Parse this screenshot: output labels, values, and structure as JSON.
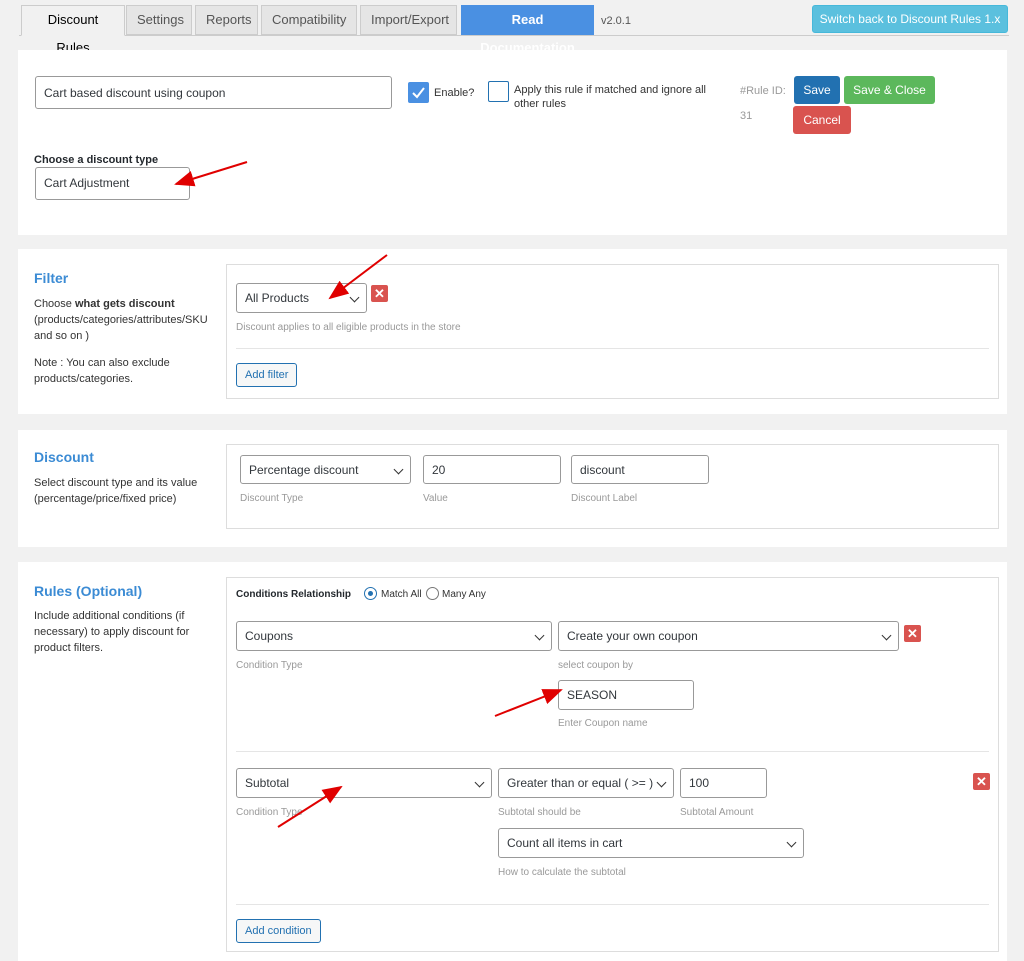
{
  "tabs": {
    "discount_rules": "Discount Rules",
    "settings": "Settings",
    "reports": "Reports",
    "compatibility": "Compatibility",
    "import_export": "Import/Export",
    "read_documentation": "Read Documentation",
    "version": "v2.0.1",
    "switch_back": "Switch back to Discount Rules 1.x"
  },
  "header": {
    "rule_name": "Cart based discount using coupon",
    "enable_label": "Enable?",
    "enable_checked": true,
    "apply_rule_label": "Apply this rule if matched and ignore all other rules",
    "apply_rule_checked": false,
    "rule_id_label": "#Rule ID:",
    "rule_id": "31",
    "save": "Save",
    "save_close": "Save & Close",
    "cancel": "Cancel",
    "discount_type_label": "Choose a discount type",
    "discount_type_value": "Cart Adjustment"
  },
  "filter": {
    "title": "Filter",
    "desc_prefix": "Choose ",
    "desc_bold": "what gets discount",
    "desc_suffix": "(products/categories/attributes/SKU and so on )",
    "note": "Note : You can also exclude products/categories.",
    "select_value": "All Products",
    "hint": "Discount applies to all eligible products in the store",
    "add_filter": "Add filter"
  },
  "discount": {
    "title": "Discount",
    "desc": "Select discount type and its value (percentage/price/fixed price)",
    "type_value": "Percentage discount",
    "type_label": "Discount Type",
    "value": "20",
    "value_label": "Value",
    "label_value": "discount",
    "label_label": "Discount Label"
  },
  "rules": {
    "title": "Rules (Optional)",
    "desc": "Include additional conditions (if necessary) to apply discount for product filters.",
    "relationship_label": "Conditions Relationship",
    "match_all": "Match All",
    "match_any": "Many Any",
    "condition1": {
      "type": "Coupons",
      "type_label": "Condition Type",
      "coupon_by": "Create your own coupon",
      "coupon_by_label": "select coupon by",
      "coupon_name": "SEASON",
      "coupon_name_label": "Enter Coupon name"
    },
    "condition2": {
      "type": "Subtotal",
      "type_label": "Condition Type",
      "operator": "Greater than or equal ( >= )",
      "operator_label": "Subtotal should be",
      "amount": "100",
      "amount_label": "Subtotal Amount",
      "calc": "Count all items in cart",
      "calc_label": "How to calculate the subtotal"
    },
    "add_condition": "Add condition"
  },
  "colors": {
    "primary_blue": "#2271b1",
    "doc_tab": "#4a90e2",
    "switch_btn": "#5bc0de",
    "save_close": "#5cb85c",
    "cancel": "#d9534f",
    "section_title": "#3b8bd4",
    "annotation_arrow": "#e00000"
  }
}
